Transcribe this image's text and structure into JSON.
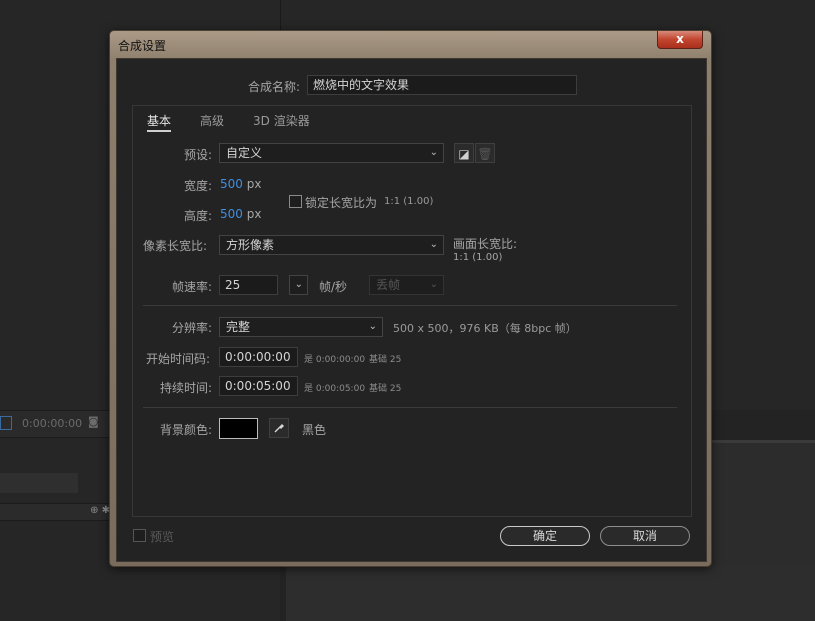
{
  "background": {
    "timeline_time": "0:00:00:00"
  },
  "dialog": {
    "title": "合成设置",
    "close_label": "x",
    "comp_name_label": "合成名称:",
    "comp_name_value": "燃烧中的文字效果",
    "tabs": [
      {
        "label": "基本",
        "active": true
      },
      {
        "label": "高级",
        "active": false
      },
      {
        "label": "3D 渲染器",
        "active": false
      }
    ],
    "preset": {
      "label": "预设:",
      "value": "自定义"
    },
    "width": {
      "label": "宽度:",
      "value": "500",
      "unit": "px"
    },
    "height": {
      "label": "高度:",
      "value": "500",
      "unit": "px"
    },
    "lock_aspect": {
      "label": "锁定长宽比为",
      "ratio": "1:1 (1.00)",
      "checked": false
    },
    "pixel_aspect": {
      "label": "像素长宽比:",
      "value": "方形像素"
    },
    "frame_aspect": {
      "label": "画面长宽比:",
      "value": "1:1 (1.00)"
    },
    "frame_rate": {
      "label": "帧速率:",
      "value": "25",
      "unit": "帧/秒",
      "drop_frame": "丢帧"
    },
    "resolution": {
      "label": "分辨率:",
      "value": "完整",
      "info": "500 x 500，976 KB（每 8bpc 帧）"
    },
    "start_timecode": {
      "label": "开始时间码:",
      "value": "0:00:00:00",
      "is": "是 0:00:00:00",
      "base": "基础 25"
    },
    "duration": {
      "label": "持续时间:",
      "value": "0:00:05:00",
      "is": "是 0:00:05:00",
      "base": "基础 25"
    },
    "bg_color": {
      "label": "背景颜色:",
      "name": "黑色",
      "color": "#000000"
    },
    "preview": {
      "label": "预览",
      "checked": false
    },
    "ok_label": "确定",
    "cancel_label": "取消"
  }
}
